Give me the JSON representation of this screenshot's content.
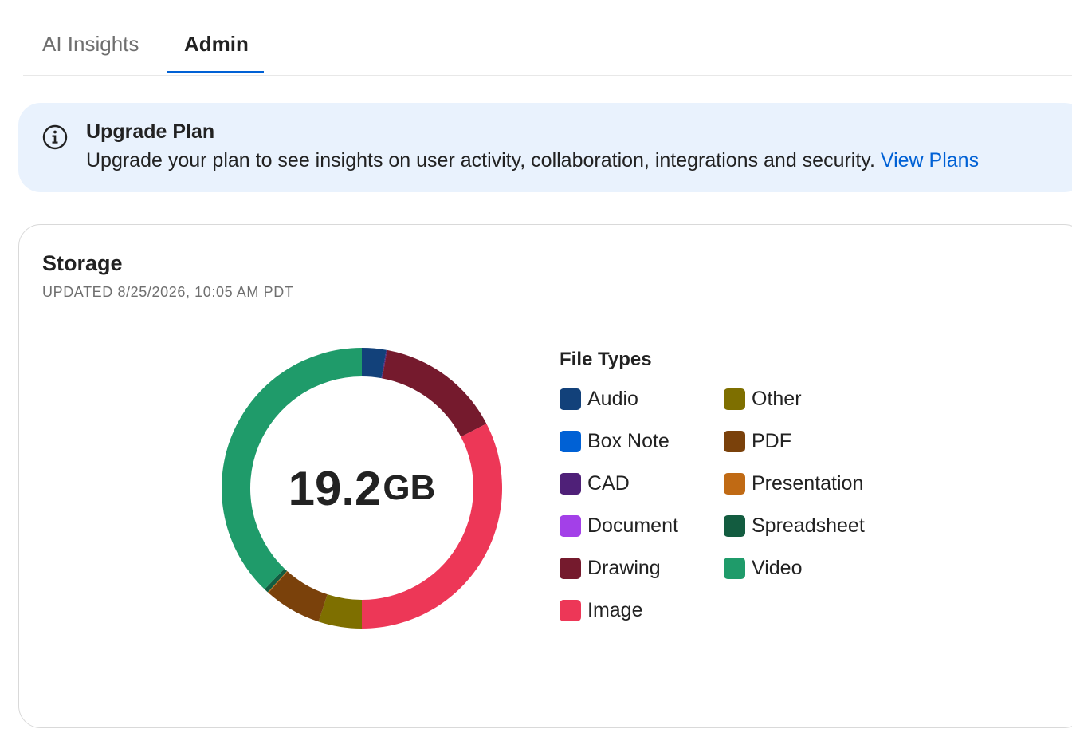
{
  "tabs": [
    {
      "label": "AI Insights"
    },
    {
      "label": "Admin",
      "active": true
    }
  ],
  "banner": {
    "icon": "info-icon",
    "title": "Upgrade Plan",
    "text": "Upgrade your plan to see insights on user activity, collaboration, integrations and security.",
    "link_label": "View Plans"
  },
  "storage": {
    "title": "Storage",
    "updated": "UPDATED 8/25/2026, 10:05 AM PDT",
    "total_value": "19.2",
    "total_unit": "GB",
    "legend_title": "File Types"
  },
  "chart_data": {
    "type": "pie",
    "title": "File Types",
    "series": [
      {
        "name": "Audio",
        "value": 2.8,
        "color": "#12417a"
      },
      {
        "name": "Box Note",
        "value": 0.0,
        "color": "#0061d5"
      },
      {
        "name": "CAD",
        "value": 0.1,
        "color": "#4f2078"
      },
      {
        "name": "Document",
        "value": 0.0,
        "color": "#a340e8"
      },
      {
        "name": "Drawing",
        "value": 14.5,
        "color": "#751a2d"
      },
      {
        "name": "Image",
        "value": 32.6,
        "color": "#ed3757"
      },
      {
        "name": "Other",
        "value": 5.0,
        "color": "#7e6f00"
      },
      {
        "name": "PDF",
        "value": 6.6,
        "color": "#7a410b"
      },
      {
        "name": "Presentation",
        "value": 0.1,
        "color": "#c06a14"
      },
      {
        "name": "Spreadsheet",
        "value": 0.5,
        "color": "#135c40"
      },
      {
        "name": "Video",
        "value": 37.8,
        "color": "#1f9b6a"
      }
    ]
  }
}
